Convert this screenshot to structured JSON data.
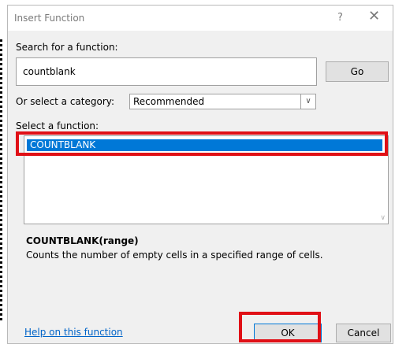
{
  "dialog": {
    "title": "Insert Function",
    "help_glyph": "?",
    "close_glyph": "✕",
    "search_label": "Search for a function:",
    "search_value": "countblank",
    "go_label": "Go",
    "category_label": "Or select a category:",
    "category_value": "Recommended",
    "function_label": "Select a function:",
    "functions": [
      "COUNTBLANK"
    ],
    "syntax": "COUNTBLANK(range)",
    "description": "Counts the number of empty cells in a specified range of cells.",
    "help_link": "Help on this function",
    "ok_label": "OK",
    "cancel_label": "Cancel"
  },
  "colors": {
    "selection": "#0078d7",
    "highlight": "#e01016",
    "link": "#0064c8"
  }
}
